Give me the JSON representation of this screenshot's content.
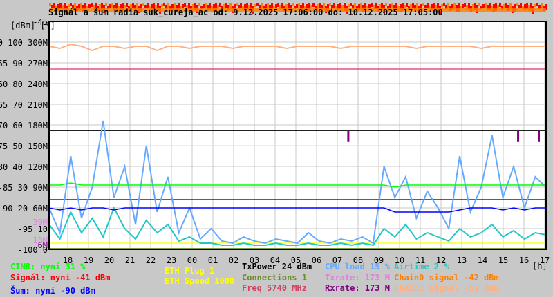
{
  "chart_data": {
    "type": "line",
    "title": "Signál a šum radia suk_cureja_ac od: 9.12.2025 17:06:00 do: 10.12.2025 17:05:00",
    "y_axis_units": "[dBm] [%]",
    "y_ticks": [
      {
        "dbm": "-45",
        "pct": "",
        "m": ""
      },
      {
        "dbm": "-50",
        "pct": "100",
        "m": "300M"
      },
      {
        "dbm": "-55",
        "pct": "90",
        "m": "270M"
      },
      {
        "dbm": "-60",
        "pct": "80",
        "m": "240M"
      },
      {
        "dbm": "-65",
        "pct": "70",
        "m": "210M"
      },
      {
        "dbm": "-70",
        "pct": "60",
        "m": "180M"
      },
      {
        "dbm": "-75",
        "pct": "50",
        "m": "150M"
      },
      {
        "dbm": "-80",
        "pct": "40",
        "m": "120M"
      },
      {
        "dbm": "-85",
        "pct": "30",
        "m": "90M"
      },
      {
        "dbm": "-90",
        "pct": "20",
        "m": "60M"
      },
      {
        "dbm": "-95",
        "pct": "10",
        "m": ""
      },
      {
        "dbm": "-100",
        "pct": "0",
        "m": ""
      }
    ],
    "extra_y_labels": [
      {
        "text": "39M",
        "color": "#e080e0",
        "dbm": -93.5
      },
      {
        "text": "13M",
        "color": "#e080e0",
        "dbm": -97.8
      },
      {
        "text": "6M",
        "color": "#800080",
        "dbm": -99
      }
    ],
    "ylim_dbm": [
      -100,
      -45
    ],
    "x_ticks": [
      "18",
      "19",
      "20",
      "21",
      "22",
      "23",
      "00",
      "01",
      "02",
      "03",
      "04",
      "05",
      "06",
      "07",
      "08",
      "09",
      "10",
      "11",
      "12",
      "13",
      "14",
      "15",
      "16",
      "17"
    ],
    "x_unit": "[h]",
    "x_range": [
      "17:06",
      "17:05"
    ],
    "grid": true,
    "sample_minutes": 30,
    "series": [
      {
        "color": "#ffb080",
        "unit": "dBm",
        "values": [
          -51,
          -51.5,
          -50.5,
          -51,
          -52,
          -51,
          -51,
          -51.5,
          -51,
          -51,
          -52,
          -51,
          -51,
          -51.5,
          -51,
          -51,
          -51,
          -51.5,
          -51,
          -51,
          -51,
          -51,
          -51.5,
          -51,
          -51,
          -51,
          -51,
          -51.5,
          -51,
          -51,
          -51,
          -51,
          -51,
          -51,
          -51.5,
          -51,
          -51,
          -51,
          -51,
          -51,
          -51.5,
          -51,
          -51,
          -51,
          -51,
          -51,
          -51
        ]
      },
      {
        "color": "#66aaff",
        "unit": "%",
        "values": [
          20,
          8,
          45,
          15,
          30,
          62,
          25,
          40,
          12,
          50,
          18,
          35,
          8,
          20,
          5,
          10,
          4,
          3,
          6,
          4,
          3,
          5,
          4,
          3,
          8,
          4,
          3,
          5,
          4,
          6,
          3,
          40,
          25,
          35,
          15,
          28,
          20,
          10,
          45,
          18,
          30,
          55,
          25,
          40,
          20,
          35,
          30
        ]
      },
      {
        "color": "#20c8c8",
        "unit": "%",
        "values": [
          12,
          5,
          18,
          8,
          15,
          6,
          20,
          10,
          5,
          14,
          8,
          12,
          4,
          6,
          3,
          3,
          2,
          2,
          3,
          2,
          2,
          3,
          2,
          2,
          3,
          2,
          2,
          3,
          2,
          3,
          2,
          10,
          6,
          12,
          5,
          8,
          6,
          4,
          10,
          6,
          8,
          12,
          6,
          9,
          5,
          8,
          7
        ]
      },
      {
        "color": "#00ff00",
        "unit": "%",
        "values": [
          31,
          31,
          32,
          31,
          31,
          31,
          31,
          31,
          31,
          31,
          31,
          31,
          31,
          31,
          31,
          31,
          31,
          31,
          31,
          31,
          31,
          31,
          31,
          31,
          31,
          31,
          31,
          31,
          31,
          31,
          31,
          31,
          30,
          31,
          31,
          31,
          31,
          31,
          31,
          31,
          31,
          31,
          31,
          31,
          31,
          31,
          31
        ]
      },
      {
        "color": "#0000ff",
        "unit": "dBm",
        "values": [
          -90,
          -90.5,
          -90,
          -90.5,
          -90,
          -90,
          -90.5,
          -90,
          -90,
          -90,
          -90,
          -90,
          -90,
          -90,
          -90,
          -90,
          -90,
          -90,
          -90,
          -90,
          -90,
          -90,
          -90,
          -90,
          -90,
          -90,
          -90,
          -90,
          -90,
          -90,
          -90,
          -90,
          -91,
          -91,
          -91,
          -91,
          -91,
          -91,
          -90.5,
          -90,
          -90,
          -90,
          -90.5,
          -90,
          -90.5,
          -90,
          -90
        ]
      }
    ],
    "reference_lines": [
      {
        "color": "#e03060",
        "dbm": -56.5
      },
      {
        "color": "#000000",
        "dbm": -71.3
      },
      {
        "color": "#ffff00",
        "dbm": -75
      },
      {
        "color": "#000000",
        "dbm": -88
      },
      {
        "color": "#ffff00",
        "dbm": -98.5
      },
      {
        "color": "#6b8e23",
        "dbm": -99.8
      }
    ],
    "signal_band": {
      "color_main": "#ff0000",
      "color_chain0": "#ff8000",
      "note_dbm": -41
    },
    "rxrate_spikes": {
      "color": "#800080",
      "hours": [
        14.4,
        22.6,
        23.6
      ]
    }
  },
  "legend": [
    {
      "text": "CINR: nyní 31 %",
      "color": "#00ff00"
    },
    {
      "text": "Signál: nyní -41 dBm",
      "color": "#ff0000"
    },
    {
      "text": "Šum: nyní -90 dBm",
      "color": "#0000ff"
    },
    {
      "text": "ETH Plug 1",
      "color": "#ffff00"
    },
    {
      "text": "ETH Speed 1000",
      "color": "#ffff00"
    },
    {
      "text": "TxPower 24 dBm",
      "color": "#000000"
    },
    {
      "text": "Connections 1",
      "color": "#6b8e23"
    },
    {
      "text": "Freq 5740 MHz",
      "color": "#d04060"
    },
    {
      "text": "CPU load 15 %",
      "color": "#66aaff"
    },
    {
      "text": "Txrate: 173 M",
      "color": "#e080e0"
    },
    {
      "text": "Rxrate: 173 M",
      "color": "#800080"
    },
    {
      "text": "Airtime 2 %",
      "color": "#20c8c8"
    },
    {
      "text": "Chain0 signal -42 dBm",
      "color": "#ff8000"
    },
    {
      "text": "Chain1 signal -51 dBm",
      "color": "#ffb080"
    }
  ]
}
